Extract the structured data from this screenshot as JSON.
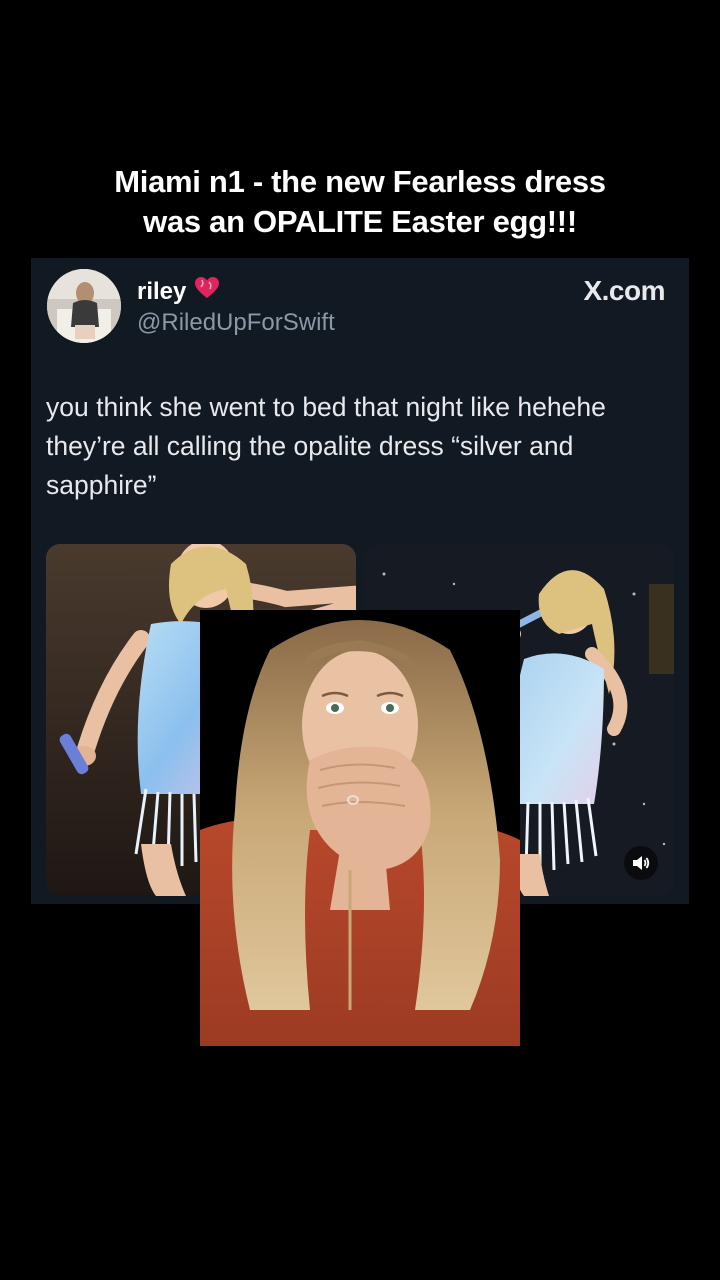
{
  "caption": {
    "line1": "Miami n1 - the new Fearless dress",
    "line2": "was an OPALITE Easter egg!!!"
  },
  "tweet": {
    "display_name": "riley",
    "handle": "@RiledUpForSwift",
    "source_label": "X.com",
    "text": "you think she went to bed that night like hehehe they’re all calling the opalite dress “silver and sapphire”",
    "photos": [
      {
        "name": "performer-photo-left"
      },
      {
        "name": "performer-photo-right"
      }
    ],
    "icons": [
      "heart-icon",
      "volume-icon"
    ]
  },
  "colors": {
    "background": "#000000",
    "tweet_card": "#111923",
    "handle_gray": "#8b98a5",
    "heart_red": "#e0245e",
    "sweater_orange": "#b5452a"
  }
}
